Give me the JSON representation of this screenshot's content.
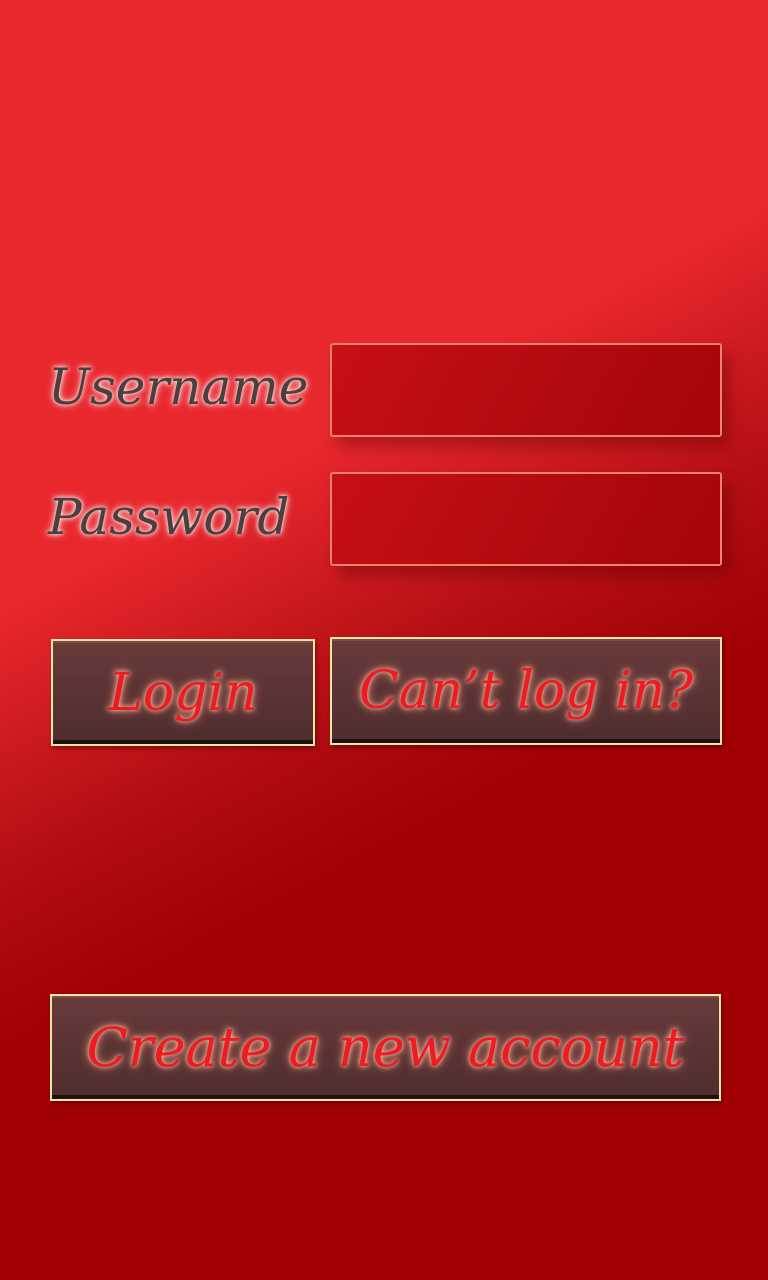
{
  "form": {
    "username_label": "Username",
    "password_label": "Password",
    "username_value": "",
    "password_value": ""
  },
  "buttons": {
    "login_label": "Login",
    "cant_login_label": "Can’t log in?",
    "create_account_label": "Create a new account"
  },
  "colors": {
    "background_light": "#e9282e",
    "background_dark": "#a10005",
    "button_fill": "#5a3333",
    "button_text": "#ee1b22",
    "field_border": "#f08070"
  }
}
